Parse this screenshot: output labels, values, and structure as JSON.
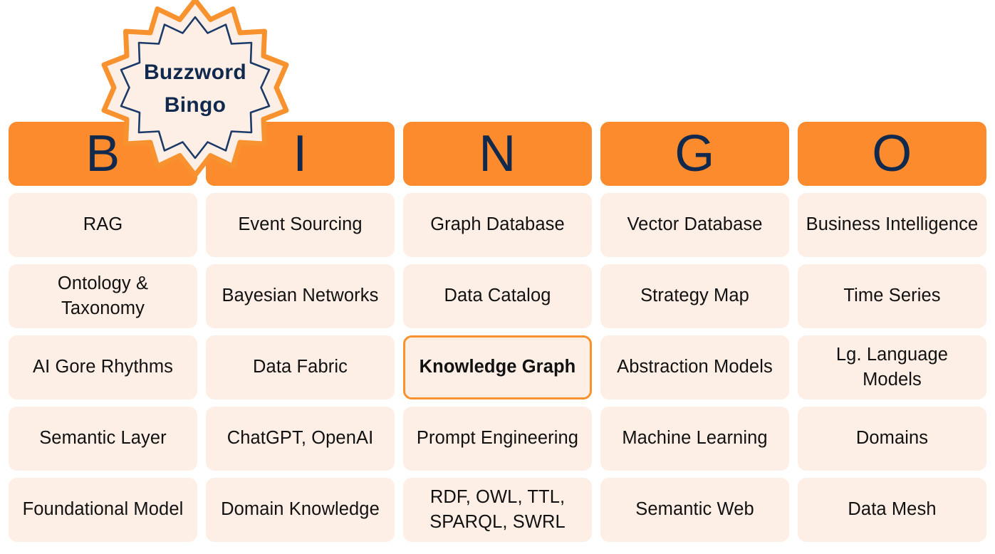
{
  "badge": {
    "line1": "Buzzword",
    "line2": "Bingo",
    "outline_color": "#f7922f",
    "inner_outline_color": "#1b3a68",
    "fill_color": "#fdefe5",
    "text_color": "#10294d"
  },
  "colors": {
    "header_background": "#fb8b2c",
    "header_letter": "#10294d",
    "cell_background": "#fdefe5",
    "cell_text": "#111111",
    "free_border": "#f7922f",
    "page_background": "#ffffff"
  },
  "headers": [
    {
      "letter": "B"
    },
    {
      "letter": "I"
    },
    {
      "letter": "N"
    },
    {
      "letter": "G"
    },
    {
      "letter": "O"
    }
  ],
  "columns": [
    {
      "letter": "B",
      "cells": [
        {
          "text": "RAG",
          "free": false
        },
        {
          "text": "Ontology & Taxonomy",
          "free": false
        },
        {
          "text": "AI Gore Rhythms",
          "free": false
        },
        {
          "text": "Semantic Layer",
          "free": false
        },
        {
          "text": "Foundational Model",
          "free": false
        }
      ]
    },
    {
      "letter": "I",
      "cells": [
        {
          "text": "Event Sourcing",
          "free": false
        },
        {
          "text": "Bayesian Networks",
          "free": false
        },
        {
          "text": "Data Fabric",
          "free": false
        },
        {
          "text": "ChatGPT, OpenAI",
          "free": false
        },
        {
          "text": "Domain Knowledge",
          "free": false
        }
      ]
    },
    {
      "letter": "N",
      "cells": [
        {
          "text": "Graph Database",
          "free": false
        },
        {
          "text": "Data Catalog",
          "free": false
        },
        {
          "text": "Knowledge Graph",
          "free": true
        },
        {
          "text": "Prompt Engineering",
          "free": false
        },
        {
          "text": "RDF, OWL, TTL, SPARQL, SWRL",
          "free": false
        }
      ]
    },
    {
      "letter": "G",
      "cells": [
        {
          "text": "Vector Database",
          "free": false
        },
        {
          "text": "Strategy Map",
          "free": false
        },
        {
          "text": "Abstraction Models",
          "free": false
        },
        {
          "text": "Machine Learning",
          "free": false
        },
        {
          "text": "Semantic Web",
          "free": false
        }
      ]
    },
    {
      "letter": "O",
      "cells": [
        {
          "text": "Business Intelligence",
          "free": false
        },
        {
          "text": "Time Series",
          "free": false
        },
        {
          "text": "Lg. Language Models",
          "free": false
        },
        {
          "text": "Domains",
          "free": false
        },
        {
          "text": "Data Mesh",
          "free": false
        }
      ]
    }
  ]
}
